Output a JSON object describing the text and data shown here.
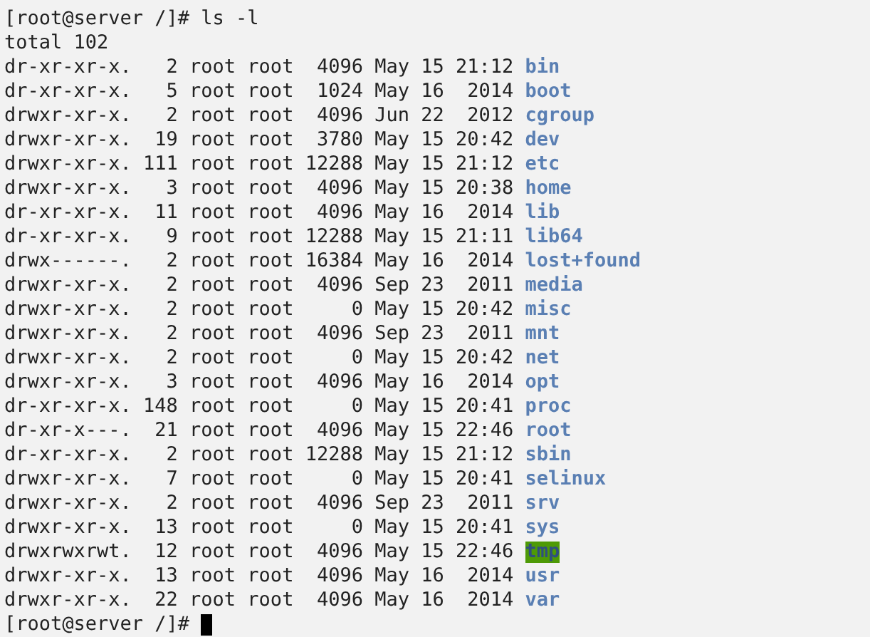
{
  "terminal": {
    "command_line": {
      "prompt": "[root@server /]#",
      "command": "ls -l"
    },
    "total": "total 102",
    "entries": [
      {
        "details": "dr-xr-xr-x.   2 root root  4096 May 15 21:12",
        "name": "bin",
        "highlighted": false
      },
      {
        "details": "dr-xr-xr-x.   5 root root  1024 May 16  2014",
        "name": "boot",
        "highlighted": false
      },
      {
        "details": "drwxr-xr-x.   2 root root  4096 Jun 22  2012",
        "name": "cgroup",
        "highlighted": false
      },
      {
        "details": "drwxr-xr-x.  19 root root  3780 May 15 20:42",
        "name": "dev",
        "highlighted": false
      },
      {
        "details": "drwxr-xr-x. 111 root root 12288 May 15 21:12",
        "name": "etc",
        "highlighted": false
      },
      {
        "details": "drwxr-xr-x.   3 root root  4096 May 15 20:38",
        "name": "home",
        "highlighted": false
      },
      {
        "details": "dr-xr-xr-x.  11 root root  4096 May 16  2014",
        "name": "lib",
        "highlighted": false
      },
      {
        "details": "dr-xr-xr-x.   9 root root 12288 May 15 21:11",
        "name": "lib64",
        "highlighted": false
      },
      {
        "details": "drwx------.   2 root root 16384 May 16  2014",
        "name": "lost+found",
        "highlighted": false
      },
      {
        "details": "drwxr-xr-x.   2 root root  4096 Sep 23  2011",
        "name": "media",
        "highlighted": false
      },
      {
        "details": "drwxr-xr-x.   2 root root     0 May 15 20:42",
        "name": "misc",
        "highlighted": false
      },
      {
        "details": "drwxr-xr-x.   2 root root  4096 Sep 23  2011",
        "name": "mnt",
        "highlighted": false
      },
      {
        "details": "drwxr-xr-x.   2 root root     0 May 15 20:42",
        "name": "net",
        "highlighted": false
      },
      {
        "details": "drwxr-xr-x.   3 root root  4096 May 16  2014",
        "name": "opt",
        "highlighted": false
      },
      {
        "details": "dr-xr-xr-x. 148 root root     0 May 15 20:41",
        "name": "proc",
        "highlighted": false
      },
      {
        "details": "dr-xr-x---.  21 root root  4096 May 15 22:46",
        "name": "root",
        "highlighted": false
      },
      {
        "details": "dr-xr-xr-x.   2 root root 12288 May 15 21:12",
        "name": "sbin",
        "highlighted": false
      },
      {
        "details": "drwxr-xr-x.   7 root root     0 May 15 20:41",
        "name": "selinux",
        "highlighted": false
      },
      {
        "details": "drwxr-xr-x.   2 root root  4096 Sep 23  2011",
        "name": "srv",
        "highlighted": false
      },
      {
        "details": "drwxr-xr-x.  13 root root     0 May 15 20:41",
        "name": "sys",
        "highlighted": false
      },
      {
        "details": "drwxrwxrwt.  12 root root  4096 May 15 22:46",
        "name": "tmp",
        "highlighted": true
      },
      {
        "details": "drwxr-xr-x.  13 root root  4096 May 16  2014",
        "name": "usr",
        "highlighted": false
      },
      {
        "details": "drwxr-xr-x.  22 root root  4096 May 16  2014",
        "name": "var",
        "highlighted": false
      }
    ],
    "prompt_line": {
      "prompt": "[root@server /]#"
    }
  }
}
